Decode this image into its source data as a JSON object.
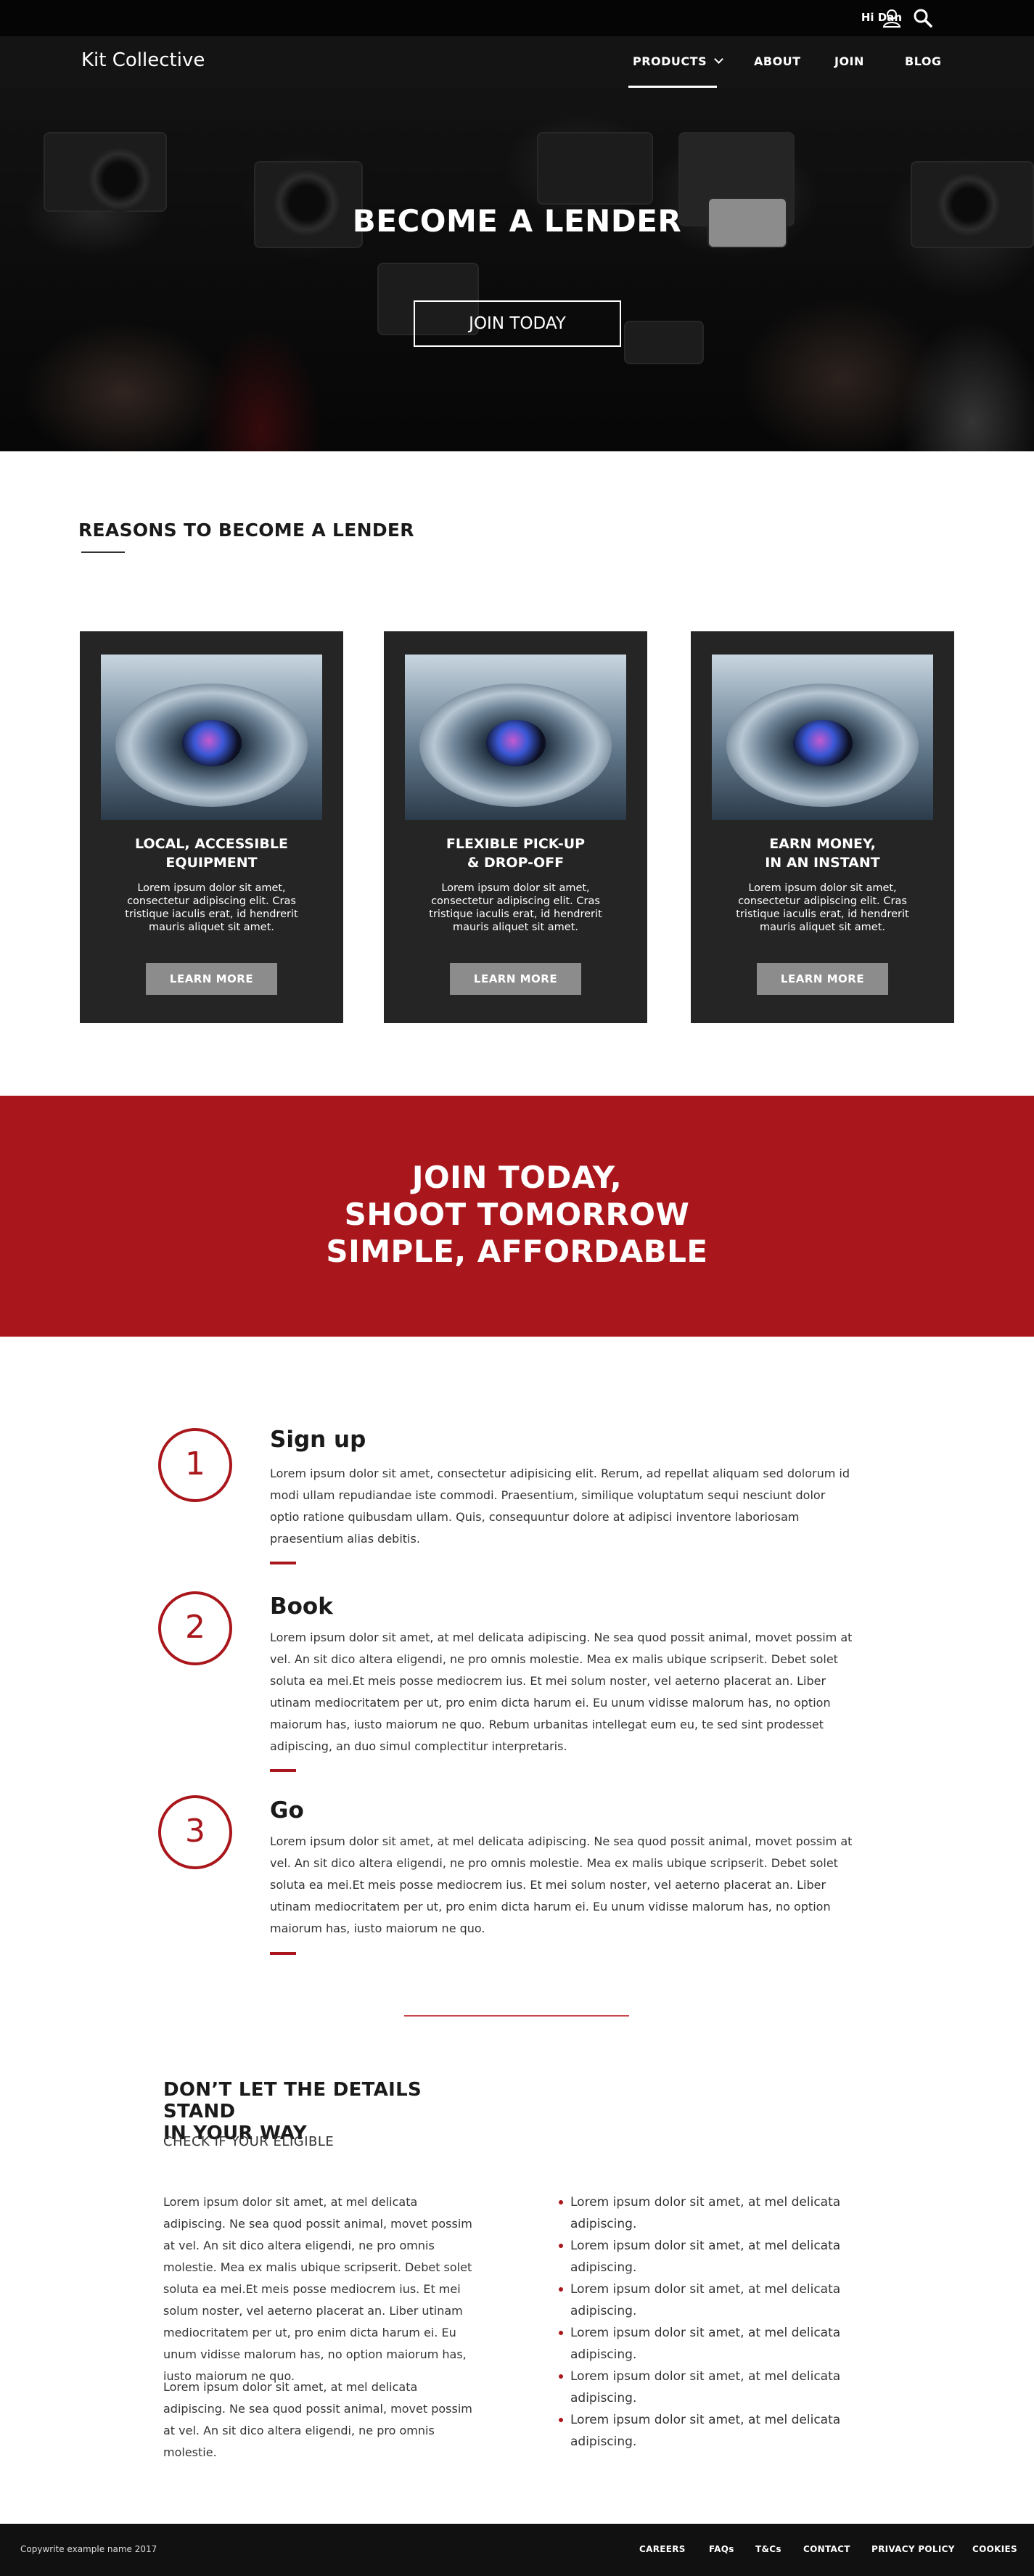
{
  "utility": {
    "greeting": "Hi Dan",
    "user_icon": "user-icon",
    "search_icon": "search-icon"
  },
  "nav": {
    "brand": "Kit Collective",
    "items": [
      {
        "label": "PRODUCTS",
        "icon": "chevron-down-icon"
      },
      {
        "label": "ABOUT"
      },
      {
        "label": "JOIN"
      },
      {
        "label": "BLOG"
      }
    ],
    "active": "PRODUCTS"
  },
  "hero": {
    "title": "BECOME A LENDER",
    "button": "JOIN TODAY"
  },
  "reasons": {
    "title": "REASONS TO BECOME A LENDER",
    "cards": [
      {
        "title_line1": "LOCAL, ACCESSIBLE",
        "title_line2": "EQUIPMENT",
        "text": "Lorem ipsum dolor sit amet, consectetur adipiscing elit. Cras tristique iaculis erat, id hendrerit mauris aliquet sit amet.",
        "button": "LEARN MORE"
      },
      {
        "title_line1": "FLEXIBLE PICK-UP",
        "title_line2": "& DROP-OFF",
        "text": "Lorem ipsum dolor sit amet, consectetur adipiscing elit. Cras tristique iaculis erat, id hendrerit mauris aliquet sit amet.",
        "button": "LEARN MORE"
      },
      {
        "title_line1": "EARN MONEY,",
        "title_line2": "IN AN INSTANT",
        "text": "Lorem ipsum dolor sit amet, consectetur adipiscing elit. Cras tristique iaculis erat, id hendrerit mauris aliquet sit amet.",
        "button": "LEARN MORE"
      }
    ]
  },
  "banner": {
    "line1": "JOIN TODAY,",
    "line2": "SHOOT TOMORROW",
    "line3": "SIMPLE, AFFORDABLE",
    "color": "#a9161b"
  },
  "steps": [
    {
      "number": "1",
      "heading": "Sign up",
      "text": "Lorem ipsum dolor sit amet, consectetur adipisicing elit. Rerum, ad repellat aliquam sed dolorum id modi ullam repudiandae iste commodi. Praesentium, similique voluptatum sequi nesciunt dolor optio ratione quibusdam ullam. Quis, consequuntur dolore at adipisci inventore laboriosam praesentium alias debitis."
    },
    {
      "number": "2",
      "heading": "Book",
      "text": "Lorem ipsum dolor sit amet, at mel delicata adipiscing. Ne sea quod possit animal, movet possim at vel. An sit dico altera eligendi, ne pro omnis molestie. Mea ex malis ubique scripserit. Debet solet soluta ea mei.Et meis posse mediocrem ius. Et mei solum noster, vel aeterno placerat an. Liber utinam mediocritatem per ut, pro enim dicta harum ei. Eu unum vidisse malorum has, no option maiorum has, iusto maiorum ne quo. Rebum urbanitas intellegat eum eu, te sed sint prodesset adipiscing, an duo simul complectitur interpretaris."
    },
    {
      "number": "3",
      "heading": "Go",
      "text": "Lorem ipsum dolor sit amet, at mel delicata adipiscing. Ne sea quod possit animal, movet possim at vel. An sit dico altera eligendi, ne pro omnis molestie. Mea ex malis ubique scripserit. Debet solet soluta ea mei.Et meis posse mediocrem ius. Et mei solum noster, vel aeterno placerat an. Liber utinam mediocritatem per ut, pro enim dicta harum ei. Eu unum vidisse malorum has, no option maiorum has, iusto maiorum ne quo."
    }
  ],
  "details": {
    "title_line1": "DON’T LET THE DETAILS STAND",
    "title_line2": "IN YOUR WAY",
    "subtitle": "CHECK IF YOUR ELIGIBLE",
    "para1": "Lorem ipsum dolor sit amet, at mel delicata adipiscing. Ne sea quod possit animal, movet possim at vel. An sit dico altera eligendi, ne pro omnis molestie. Mea ex malis ubique scripserit. Debet solet soluta ea mei.Et meis posse mediocrem ius. Et mei solum noster, vel aeterno placerat an. Liber utinam mediocritatem per ut, pro enim dicta harum ei. Eu unum vidisse malorum has, no option maiorum has, iusto maiorum ne quo.",
    "para2": "Lorem ipsum dolor sit amet, at mel delicata adipiscing. Ne sea quod possit animal, movet possim at vel. An sit dico altera eligendi, ne pro omnis molestie.",
    "bullets": [
      "Lorem ipsum dolor sit amet, at mel delicata adipiscing.",
      "Lorem ipsum dolor sit amet, at mel delicata adipiscing.",
      "Lorem ipsum dolor sit amet, at mel delicata adipiscing.",
      "Lorem ipsum dolor sit amet, at mel delicata adipiscing.",
      "Lorem ipsum dolor sit amet, at mel delicata adipiscing.",
      "Lorem ipsum dolor sit amet, at mel delicata adipiscing."
    ]
  },
  "footer": {
    "copyright": "Copywrite example name 2017",
    "links": [
      "CAREERS",
      "FAQs",
      "T&Cs",
      "CONTACT",
      "PRIVACY POLICY",
      "COOKIES"
    ]
  }
}
